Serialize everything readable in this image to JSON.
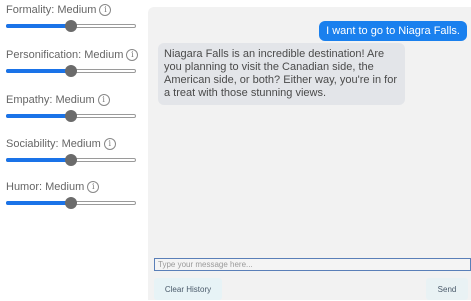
{
  "sliders": [
    {
      "label": "Formality: Medium",
      "value": 0.5
    },
    {
      "label": "Personification: Medium",
      "value": 0.5
    },
    {
      "label": "Empathy: Medium",
      "value": 0.5
    },
    {
      "label": "Sociability: Medium",
      "value": 0.5
    },
    {
      "label": "Humor: Medium",
      "value": 0.5
    }
  ],
  "info_glyph": "i",
  "chat": {
    "messages": [
      {
        "role": "user",
        "text": "I want to go to Niagra Falls."
      },
      {
        "role": "assistant",
        "text": "Niagara Falls is an incredible destination! Are you planning to visit the Canadian side, the American side, or both? Either way, you're in for a treat with those stunning views."
      }
    ],
    "input": {
      "placeholder": "Type your message here...",
      "value": ""
    },
    "clear_label": "Clear History",
    "send_label": "Send"
  },
  "colors": {
    "accent": "#1a73e8",
    "user_bubble": "#1a80ee",
    "bot_bubble": "#e3e5e9",
    "chat_background": "#f2f2f2"
  }
}
